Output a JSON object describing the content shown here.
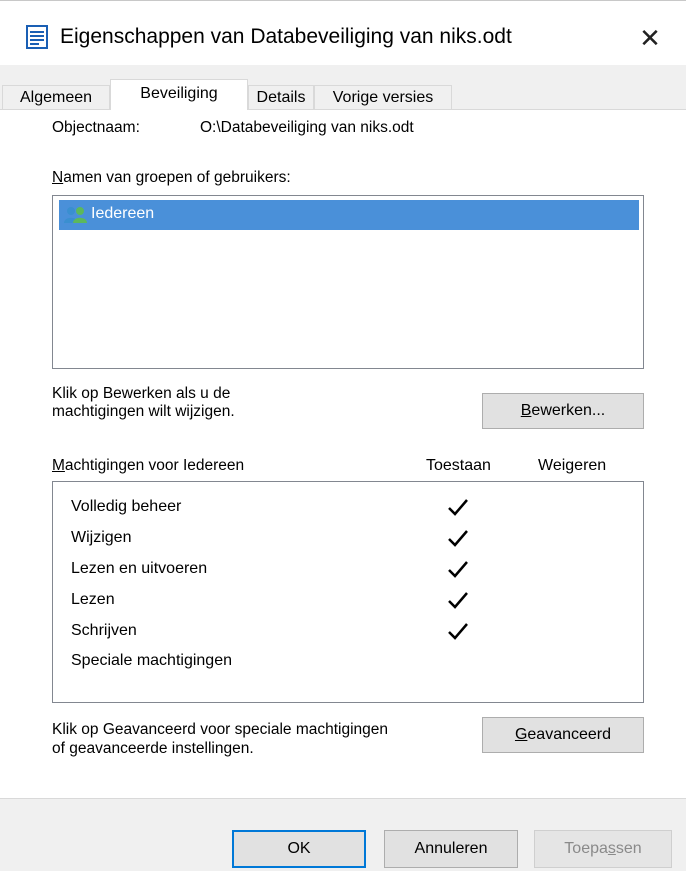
{
  "window": {
    "title": "Eigenschappen van Databeveiliging van niks.odt",
    "close_glyph": "✕",
    "title_icon": "document-icon"
  },
  "tabs": [
    {
      "label": "Algemeen",
      "active": false
    },
    {
      "label": "Beveiliging",
      "active": true
    },
    {
      "label": "Details",
      "active": false
    },
    {
      "label": "Vorige versies",
      "active": false
    }
  ],
  "security": {
    "object_name_label": "Objectnaam:",
    "object_name_value": "O:\\Databeveiliging van niks.odt",
    "groups_label_accel": "N",
    "groups_label_rest": "amen van groepen of gebruikers:",
    "groups": [
      {
        "name": "Iedereen",
        "selected": true,
        "icon": "users-group-icon"
      }
    ],
    "edit_hint_line1": "Klik op Bewerken als u de",
    "edit_hint_line2": "machtigingen wilt wijzigen.",
    "edit_button_accel": "B",
    "edit_button_rest": "ewerken...",
    "permissions_label_accel": "M",
    "permissions_label_rest": "achtigingen voor Iedereen",
    "allow_header": "Toestaan",
    "deny_header": "Weigeren",
    "permissions": [
      {
        "name": "Volledig beheer",
        "allow": true,
        "deny": false
      },
      {
        "name": "Wijzigen",
        "allow": true,
        "deny": false
      },
      {
        "name": "Lezen en uitvoeren",
        "allow": true,
        "deny": false
      },
      {
        "name": "Lezen",
        "allow": true,
        "deny": false
      },
      {
        "name": "Schrijven",
        "allow": true,
        "deny": false
      },
      {
        "name": "Speciale machtigingen",
        "allow": false,
        "deny": false
      }
    ],
    "advanced_hint_line1": "Klik op Geavanceerd voor speciale machtigingen",
    "advanced_hint_line2": "of geavanceerde instellingen.",
    "advanced_button_accel": "G",
    "advanced_button_rest": "eavanceerd"
  },
  "footer": {
    "ok_label": "OK",
    "cancel_label": "Annuleren",
    "apply_label_pre": "Toepa",
    "apply_label_accel": "s",
    "apply_label_post": "sen"
  },
  "colors": {
    "selection": "#4a90d9",
    "focus_border": "#0078d7",
    "dialog_bg": "#f0f0f0"
  }
}
